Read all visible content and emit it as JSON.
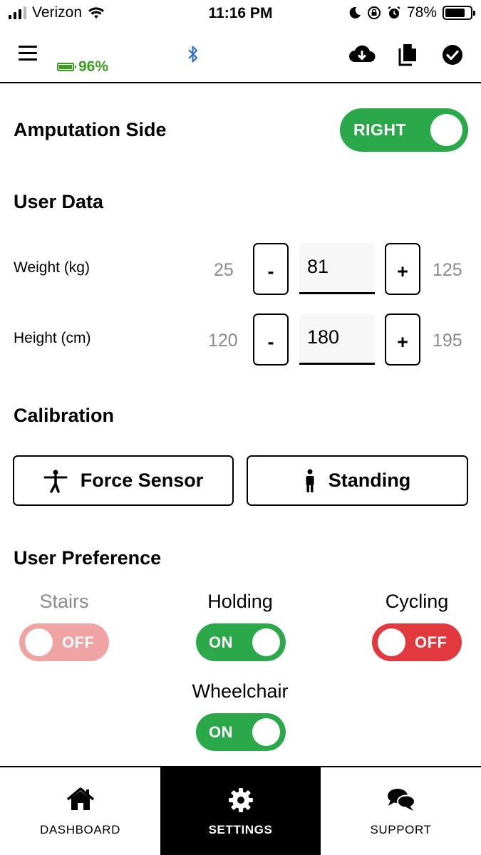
{
  "status_bar": {
    "carrier": "Verizon",
    "time": "11:16 PM",
    "battery_percent": "78%",
    "battery_level": 0.78,
    "icons": [
      "signal-icon",
      "wifi-icon",
      "moon-icon",
      "rotation-lock-icon",
      "alarm-icon",
      "battery-icon"
    ]
  },
  "toolbar": {
    "device_battery": "96%",
    "device_battery_color": "#3c9e23",
    "bluetooth_color": "#2f6fd6",
    "icons": [
      "menu-icon",
      "device-battery-icon",
      "bluetooth-icon",
      "cloud-download-icon",
      "copy-icon",
      "check-circle-icon"
    ]
  },
  "amputation": {
    "label": "Amputation Side",
    "toggle_label": "RIGHT",
    "toggle_color": "#2aa84a"
  },
  "user_data": {
    "heading": "User Data",
    "weight": {
      "label": "Weight (kg)",
      "min": "25",
      "value": "81",
      "max": "125",
      "minus": "-",
      "plus": "+"
    },
    "height": {
      "label": "Height (cm)",
      "min": "120",
      "value": "180",
      "max": "195",
      "minus": "-",
      "plus": "+"
    }
  },
  "calibration": {
    "heading": "Calibration",
    "force_sensor_label": "Force Sensor",
    "standing_label": "Standing"
  },
  "preferences": {
    "heading": "User Preference",
    "stairs": {
      "label": "Stairs",
      "state": "OFF",
      "color": "#f0a3a3",
      "label_color": "#8a8a8a"
    },
    "holding": {
      "label": "Holding",
      "state": "ON",
      "color": "#2aa84a"
    },
    "cycling": {
      "label": "Cycling",
      "state": "OFF",
      "color": "#e2393e"
    },
    "wheelchair": {
      "label": "Wheelchair",
      "state": "ON",
      "color": "#2aa84a"
    }
  },
  "bottom_nav": {
    "dashboard": "DASHBOARD",
    "settings": "SETTINGS",
    "support": "SUPPORT",
    "active": "settings"
  }
}
